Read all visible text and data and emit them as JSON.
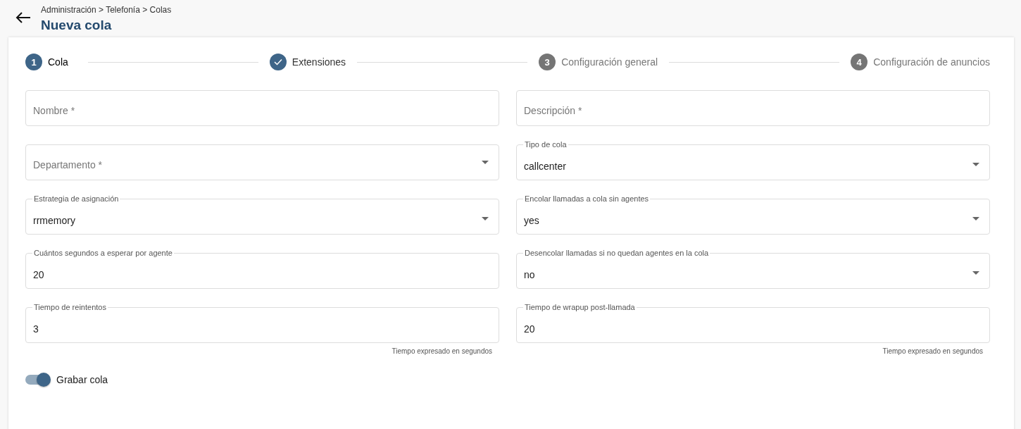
{
  "header": {
    "breadcrumb": "Administración > Telefonía > Colas",
    "title": "Nueva cola"
  },
  "steps": [
    {
      "number": "1",
      "label": "Cola",
      "selected": true,
      "completed": false
    },
    {
      "label": "Extensiones",
      "selected": false,
      "completed": true
    },
    {
      "number": "3",
      "label": "Configuración general",
      "selected": false,
      "completed": false
    },
    {
      "number": "4",
      "label": "Configuración de anuncios",
      "selected": false,
      "completed": false
    }
  ],
  "form_rows": [
    {
      "fields": [
        {
          "kind": "text",
          "placeholder": "Nombre *"
        },
        {
          "kind": "text",
          "placeholder": "Descripción *"
        }
      ]
    },
    {
      "fields": [
        {
          "kind": "select",
          "placeholder": "Departamento *"
        },
        {
          "kind": "select",
          "label": "Tipo de cola",
          "value": "callcenter"
        }
      ]
    },
    {
      "fields": [
        {
          "kind": "select",
          "label": "Estrategia de asignación",
          "value": "rrmemory"
        },
        {
          "kind": "select",
          "label": "Encolar llamadas a cola sin agentes",
          "value": "yes"
        }
      ]
    },
    {
      "fields": [
        {
          "kind": "text",
          "label": "Cuántos segundos a esperar por agente",
          "value": "20"
        },
        {
          "kind": "select",
          "label": "Desencolar llamadas si no quedan agentes en la cola",
          "value": "no"
        }
      ]
    },
    {
      "fields": [
        {
          "kind": "text",
          "label": "Tiempo de reintentos",
          "value": "3",
          "hint": "Tiempo expresado en segundos"
        },
        {
          "kind": "text",
          "label": "Tiempo de wrapup post-llamada",
          "value": "20",
          "hint": "Tiempo expresado en segundos"
        }
      ]
    }
  ],
  "toggle": {
    "label": "Grabar cola",
    "on": true
  }
}
